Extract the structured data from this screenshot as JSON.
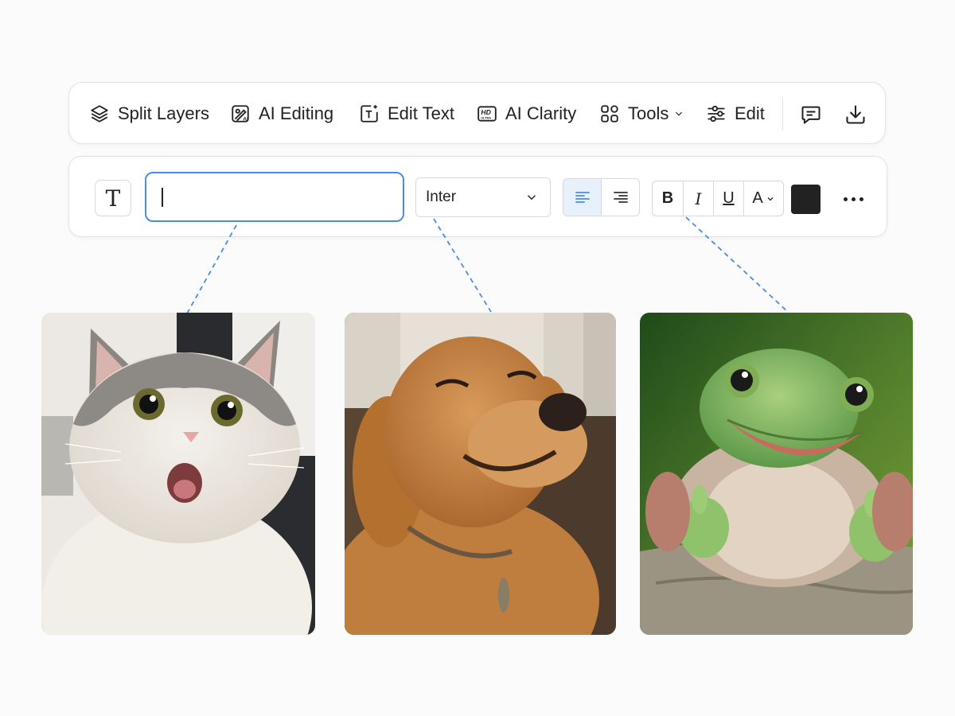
{
  "toolbar": {
    "items": [
      {
        "label": "Split Layers",
        "icon": "layers-icon"
      },
      {
        "label": "AI Editing",
        "icon": "ai-edit-icon"
      },
      {
        "label": "Edit Text",
        "icon": "edit-text-icon"
      },
      {
        "label": "AI Clarity",
        "icon": "hd-ultra-icon"
      },
      {
        "label": "Tools",
        "icon": "grid-icon"
      },
      {
        "label": "Edit",
        "icon": "sliders-icon"
      }
    ],
    "comment_icon": "comment-icon",
    "download_icon": "download-icon"
  },
  "format_bar": {
    "text_tool_glyph": "T",
    "text_input_value": "",
    "font": "Inter",
    "align_options": [
      "left",
      "right"
    ],
    "align_selected": "left",
    "style_buttons": {
      "bold": "B",
      "italic": "I",
      "underline": "U",
      "case": "A"
    },
    "text_color": "#222222",
    "more_icon": "more-horizontal-icon"
  },
  "colors": {
    "accent": "#4a8be5",
    "active_segment_bg": "#e8f0fc",
    "connector": "#4a8be5"
  },
  "images": [
    "cat-photo",
    "dog-photo",
    "frog-photo"
  ]
}
